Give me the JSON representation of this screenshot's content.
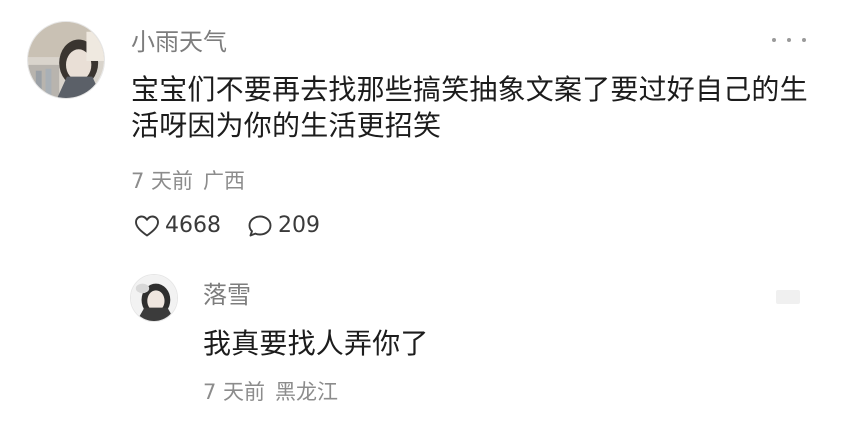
{
  "comment": {
    "username": "小雨天气",
    "text": "宝宝们不要再去找那些搞笑抽象文案了要过好自己的生活呀因为你的生活更招笑",
    "time": "7 天前",
    "location": "广西",
    "likes": "4668",
    "replies": "209",
    "avatar_icon": "avatar-photo-icon",
    "more_icon": "more-dots-icon"
  },
  "reply": {
    "username": "落雪",
    "text": "我真要找人弄你了",
    "time": "7 天前",
    "location": "黑龙江",
    "avatar_icon": "avatar-photo-icon"
  },
  "icons": {
    "like": "heart-outline-icon",
    "comment": "speech-bubble-icon"
  },
  "colors": {
    "username": "#7d7d7d",
    "body_text": "#1c1c1c",
    "meta": "#8c8c8c",
    "actions": "#3a3a3a"
  }
}
